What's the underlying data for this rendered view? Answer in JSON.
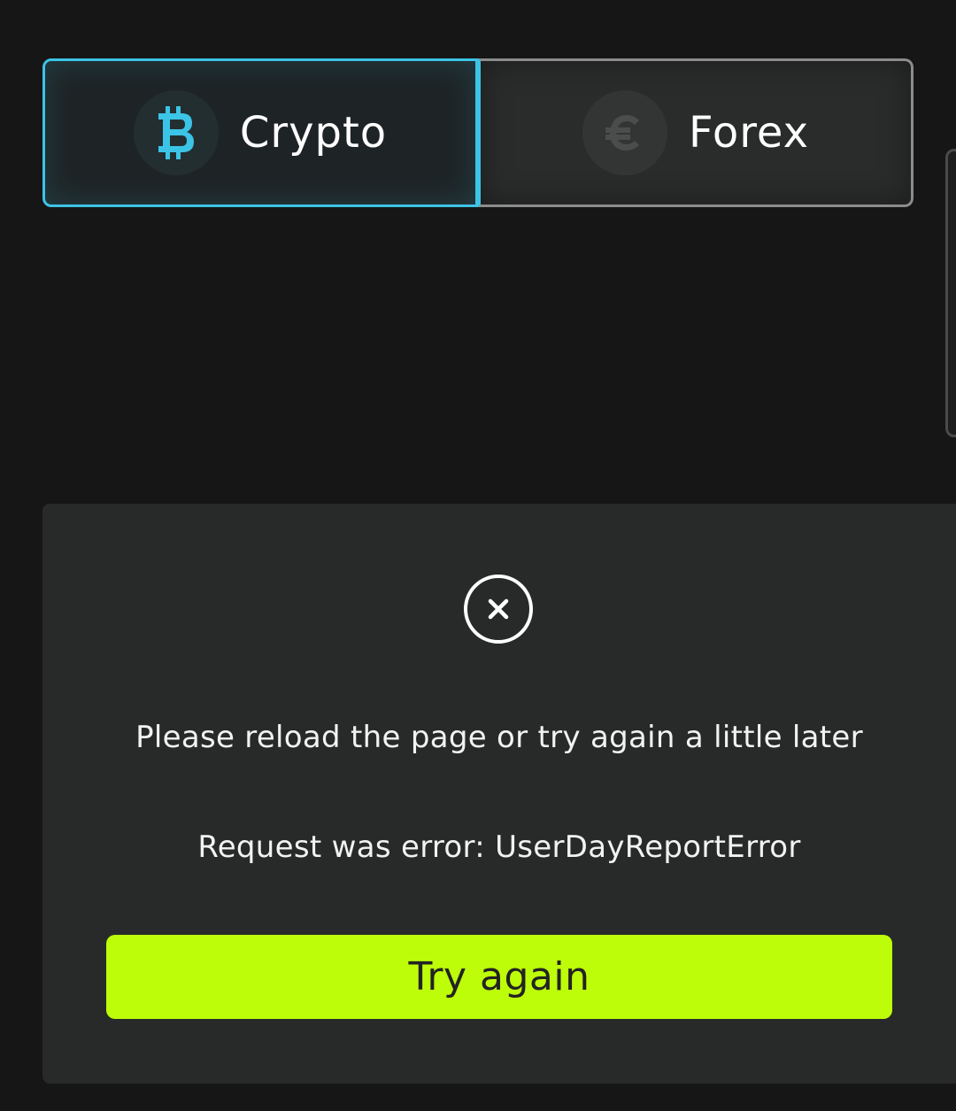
{
  "market_tabs": {
    "selected": "crypto",
    "items": [
      {
        "id": "crypto",
        "label": "Crypto",
        "icon": "bitcoin-icon",
        "icon_glyph": "B",
        "icon_color": "#3cc4e6"
      },
      {
        "id": "forex",
        "label": "Forex",
        "icon": "euro-icon",
        "icon_glyph": "€",
        "icon_color": "#4b4d4d"
      }
    ]
  },
  "error_panel": {
    "icon": "close-circle-icon",
    "message": "Please reload the page or try again a little later",
    "detail": "Request was error: UserDayReportError",
    "retry_label": "Try again"
  },
  "colors": {
    "background": "#161616",
    "card": "#282a2a",
    "accent": "#3cc4e6",
    "button": "#bdfd09"
  }
}
